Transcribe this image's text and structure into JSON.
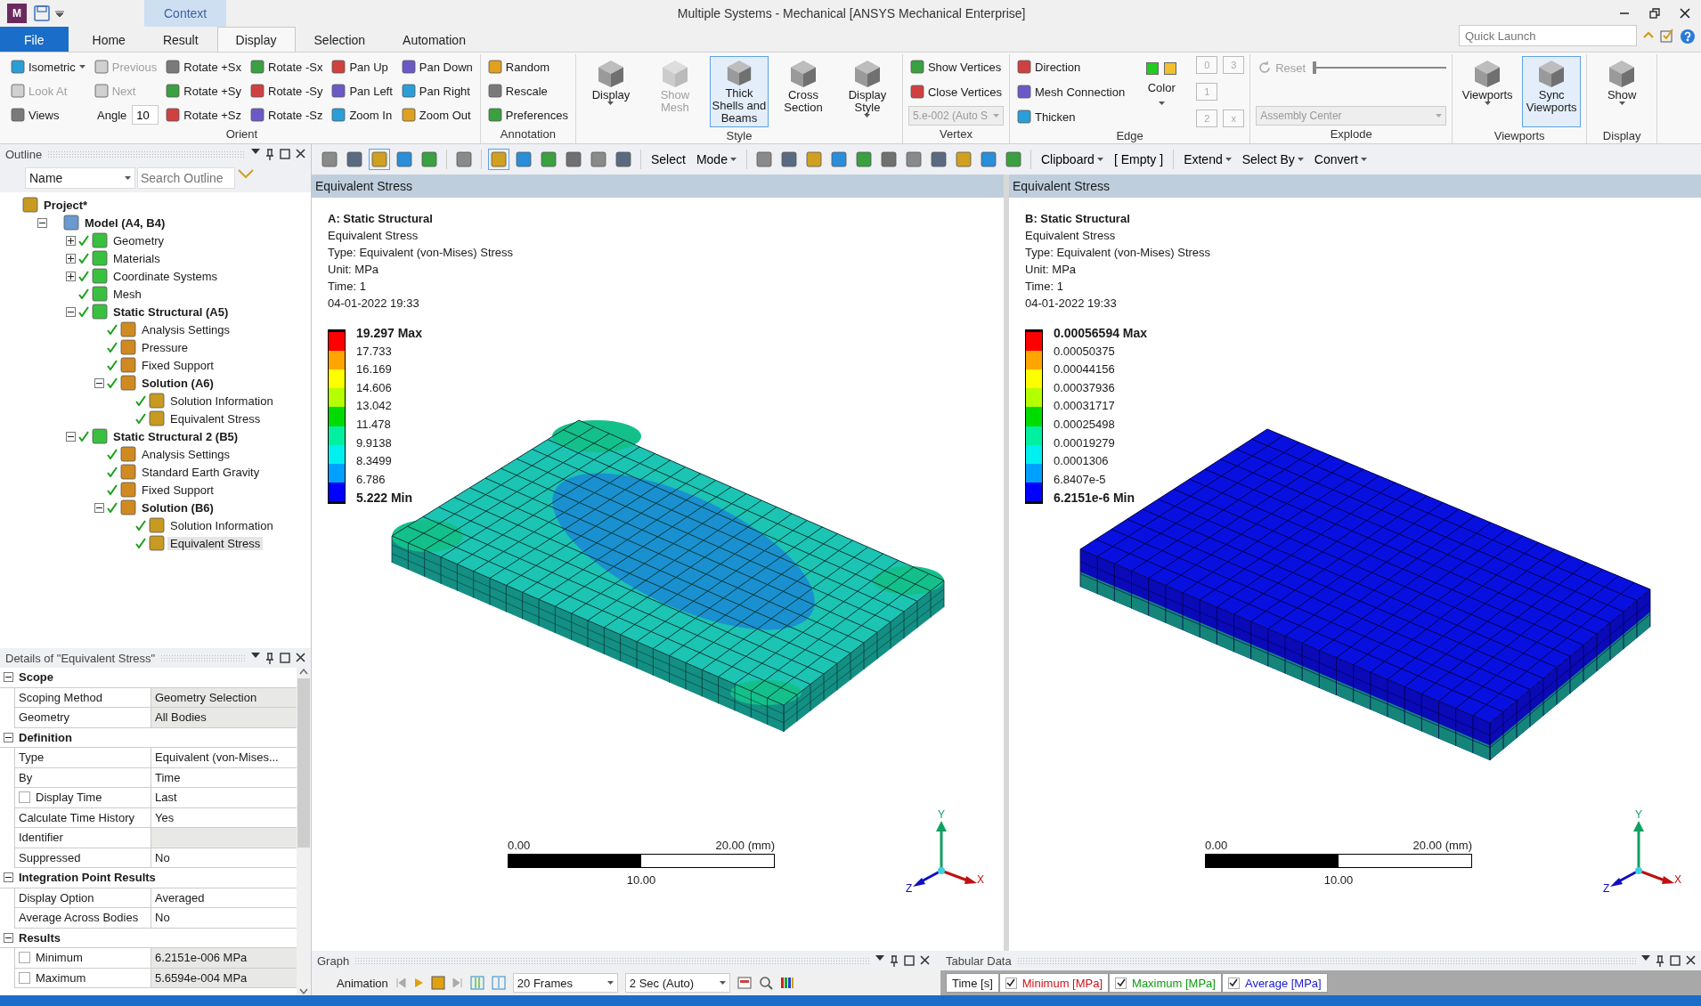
{
  "window": {
    "app_icon": "M",
    "context_tab": "Context",
    "title": "Multiple Systems - Mechanical [ANSYS Mechanical Enterprise]"
  },
  "quick_launch": {
    "placeholder": "Quick Launch"
  },
  "ribbon_tabs": [
    {
      "label": "File",
      "kind": "file",
      "selected": false
    },
    {
      "label": "Home",
      "kind": "tab",
      "selected": false
    },
    {
      "label": "Result",
      "kind": "tab",
      "selected": false
    },
    {
      "label": "Display",
      "kind": "tab",
      "selected": true
    },
    {
      "label": "Selection",
      "kind": "tab",
      "selected": false
    },
    {
      "label": "Automation",
      "kind": "tab",
      "selected": false
    }
  ],
  "ribbon_groups": [
    {
      "label": "Orient",
      "columns": [
        [
          {
            "kind": "small",
            "label": "Isometric",
            "dropdown": true,
            "disabled": false
          },
          {
            "kind": "small",
            "label": "Look At",
            "dropdown": false,
            "disabled": true
          },
          {
            "kind": "small",
            "label": "Views",
            "dropdown": false,
            "disabled": false
          }
        ],
        [
          {
            "kind": "small",
            "label": "Previous",
            "dropdown": false,
            "disabled": true
          },
          {
            "kind": "small",
            "label": "Next",
            "dropdown": false,
            "disabled": true
          },
          {
            "kind": "field",
            "label": "Angle",
            "value": "10"
          }
        ],
        [
          {
            "kind": "small",
            "label": "Rotate +Sx",
            "dropdown": false,
            "disabled": false
          },
          {
            "kind": "small",
            "label": "Rotate +Sy",
            "dropdown": false,
            "disabled": false
          },
          {
            "kind": "small",
            "label": "Rotate +Sz",
            "dropdown": false,
            "disabled": false
          }
        ],
        [
          {
            "kind": "small",
            "label": "Rotate -Sx",
            "dropdown": false,
            "disabled": false
          },
          {
            "kind": "small",
            "label": "Rotate -Sy",
            "dropdown": false,
            "disabled": false
          },
          {
            "kind": "small",
            "label": "Rotate -Sz",
            "dropdown": false,
            "disabled": false
          }
        ],
        [
          {
            "kind": "small",
            "label": "Pan Up",
            "dropdown": false,
            "disabled": false
          },
          {
            "kind": "small",
            "label": "Pan Left",
            "dropdown": false,
            "disabled": false
          },
          {
            "kind": "small",
            "label": "Zoom In",
            "dropdown": false,
            "disabled": false
          }
        ],
        [
          {
            "kind": "small",
            "label": "Pan Down",
            "dropdown": false,
            "disabled": false
          },
          {
            "kind": "small",
            "label": "Pan Right",
            "dropdown": false,
            "disabled": false
          },
          {
            "kind": "small",
            "label": "Zoom Out",
            "dropdown": false,
            "disabled": false
          }
        ]
      ]
    },
    {
      "label": "Annotation",
      "columns": [
        [
          {
            "kind": "small",
            "label": "Random",
            "dropdown": false,
            "disabled": false
          },
          {
            "kind": "small",
            "label": "Rescale",
            "dropdown": false,
            "disabled": false
          },
          {
            "kind": "small",
            "label": "Preferences",
            "dropdown": false,
            "disabled": false
          }
        ]
      ]
    },
    {
      "label": "Style",
      "columns": [
        [
          {
            "kind": "large",
            "label": "Display",
            "dropdown": true,
            "disabled": false,
            "selected": false
          }
        ],
        [
          {
            "kind": "large",
            "label": "Show Mesh",
            "dropdown": false,
            "disabled": true,
            "selected": false
          }
        ],
        [
          {
            "kind": "large",
            "label": "Thick Shells and Beams",
            "dropdown": false,
            "disabled": false,
            "selected": true
          }
        ],
        [
          {
            "kind": "large",
            "label": "Cross Section",
            "dropdown": false,
            "disabled": false,
            "selected": false
          }
        ],
        [
          {
            "kind": "large",
            "label": "Display Style",
            "dropdown": true,
            "disabled": false,
            "selected": false
          }
        ]
      ]
    },
    {
      "label": "Vertex",
      "columns": [
        [
          {
            "kind": "small",
            "label": "Show Vertices",
            "dropdown": false,
            "disabled": false
          },
          {
            "kind": "small",
            "label": "Close Vertices",
            "dropdown": false,
            "disabled": false
          },
          {
            "kind": "combo",
            "value": "5.e-002 (Auto S",
            "disabled": true
          }
        ]
      ]
    },
    {
      "label": "Edge",
      "columns": [
        [
          {
            "kind": "small",
            "label": "Direction",
            "dropdown": false,
            "disabled": false
          },
          {
            "kind": "small",
            "label": "Mesh Connection",
            "dropdown": false,
            "disabled": false
          },
          {
            "kind": "small",
            "label": "Thicken",
            "dropdown": false,
            "disabled": false
          }
        ],
        [
          {
            "kind": "color",
            "label": "Color",
            "swatches": [
              {
                "color": "#22cc22"
              },
              {
                "color": "#f0c030"
              }
            ]
          }
        ],
        [
          {
            "kind": "mini",
            "label": "0",
            "disabled": true
          },
          {
            "kind": "mini",
            "label": "1",
            "disabled": true
          },
          {
            "kind": "mini",
            "label": "2",
            "disabled": true
          }
        ],
        [
          {
            "kind": "mini",
            "label": "3",
            "disabled": true
          },
          {
            "kind": "mini",
            "label": "x",
            "disabled": true
          }
        ]
      ]
    },
    {
      "label": "Explode",
      "columns": [
        [
          {
            "kind": "slider",
            "label": "Reset",
            "disabled": true,
            "level": 0
          },
          {
            "kind": "combo",
            "value": "Assembly Center",
            "disabled": true
          }
        ]
      ]
    },
    {
      "label": "Viewports",
      "columns": [
        [
          {
            "kind": "large",
            "label": "Viewports",
            "dropdown": true,
            "disabled": false,
            "selected": false
          }
        ],
        [
          {
            "kind": "large",
            "label": "Sync Viewports",
            "dropdown": false,
            "disabled": false,
            "selected": true
          }
        ]
      ]
    },
    {
      "label": "Display",
      "columns": [
        [
          {
            "kind": "large",
            "label": "Show",
            "dropdown": true,
            "disabled": false,
            "selected": false
          }
        ]
      ]
    }
  ],
  "outline": {
    "title": "Outline",
    "filter": "Name",
    "search_placeholder": "Search Outline",
    "tree": [
      {
        "label": "Project*",
        "bold": true,
        "checked": false,
        "selected": false,
        "children": [
          {
            "label": "Model (A4, B4)",
            "bold": true,
            "checked": false,
            "selected": false,
            "expanded": true,
            "children": [
              {
                "label": "Geometry",
                "bold": false,
                "checked": true,
                "selected": false,
                "expanded": false
              },
              {
                "label": "Materials",
                "bold": false,
                "checked": true,
                "selected": false,
                "expanded": false
              },
              {
                "label": "Coordinate Systems",
                "bold": false,
                "checked": true,
                "selected": false,
                "expanded": false
              },
              {
                "label": "Mesh",
                "bold": false,
                "checked": true,
                "selected": false
              },
              {
                "label": "Static Structural (A5)",
                "bold": true,
                "checked": true,
                "selected": false,
                "expanded": true,
                "children": [
                  {
                    "label": "Analysis Settings",
                    "bold": false,
                    "checked": true,
                    "selected": false
                  },
                  {
                    "label": "Pressure",
                    "bold": false,
                    "checked": true,
                    "selected": false
                  },
                  {
                    "label": "Fixed Support",
                    "bold": false,
                    "checked": true,
                    "selected": false
                  },
                  {
                    "label": "Solution (A6)",
                    "bold": true,
                    "checked": true,
                    "selected": false,
                    "expanded": true,
                    "children": [
                      {
                        "label": "Solution Information",
                        "bold": false,
                        "checked": true,
                        "selected": false
                      },
                      {
                        "label": "Equivalent Stress",
                        "bold": false,
                        "checked": true,
                        "selected": false
                      }
                    ]
                  }
                ]
              },
              {
                "label": "Static Structural 2 (B5)",
                "bold": true,
                "checked": true,
                "selected": false,
                "expanded": true,
                "children": [
                  {
                    "label": "Analysis Settings",
                    "bold": false,
                    "checked": true,
                    "selected": false
                  },
                  {
                    "label": "Standard Earth Gravity",
                    "bold": false,
                    "checked": true,
                    "selected": false
                  },
                  {
                    "label": "Fixed Support",
                    "bold": false,
                    "checked": true,
                    "selected": false
                  },
                  {
                    "label": "Solution (B6)",
                    "bold": true,
                    "checked": true,
                    "selected": false,
                    "expanded": true,
                    "children": [
                      {
                        "label": "Solution Information",
                        "bold": false,
                        "checked": true,
                        "selected": false
                      },
                      {
                        "label": "Equivalent Stress",
                        "bold": false,
                        "checked": true,
                        "selected": true
                      }
                    ]
                  }
                ]
              }
            ]
          }
        ]
      }
    ]
  },
  "details": {
    "title": "Details of \"Equivalent Stress\"",
    "sections": [
      {
        "label": "Scope",
        "expanded": true,
        "rows": [
          {
            "kind": "plain",
            "label": "Scoping Method",
            "value": "Geometry Selection",
            "readonly": true
          },
          {
            "kind": "plain",
            "label": "Geometry",
            "value": "All Bodies",
            "readonly": true
          }
        ]
      },
      {
        "label": "Definition",
        "expanded": true,
        "rows": [
          {
            "kind": "plain",
            "label": "Type",
            "value": "Equivalent (von-Mises...",
            "readonly": false
          },
          {
            "kind": "plain",
            "label": "By",
            "value": "Time",
            "readonly": false
          },
          {
            "kind": "check",
            "label": "Display Time",
            "value": "Last",
            "readonly": false,
            "checked": false
          },
          {
            "kind": "plain",
            "label": "Calculate Time History",
            "value": "Yes",
            "readonly": false
          },
          {
            "kind": "plain",
            "label": "Identifier",
            "readonly": true
          },
          {
            "kind": "plain",
            "label": "Suppressed",
            "value": "No",
            "readonly": false
          }
        ]
      },
      {
        "label": "Integration Point Results",
        "expanded": true,
        "rows": [
          {
            "kind": "plain",
            "label": "Display Option",
            "value": "Averaged",
            "readonly": false
          },
          {
            "kind": "plain",
            "label": "Average Across Bodies",
            "value": "No",
            "readonly": false
          }
        ]
      },
      {
        "label": "Results",
        "expanded": true,
        "rows": [
          {
            "kind": "check",
            "label": "Minimum",
            "value": "6.2151e-006 MPa",
            "readonly": true,
            "checked": false
          },
          {
            "kind": "check",
            "label": "Maximum",
            "value": "5.6594e-004 MPa",
            "readonly": true,
            "checked": false
          }
        ]
      }
    ]
  },
  "graphics_toolbar": [
    {
      "kind": "icon",
      "selected": false
    },
    {
      "kind": "icon",
      "selected": false
    },
    {
      "kind": "icon",
      "selected": true
    },
    {
      "kind": "icon",
      "selected": false
    },
    {
      "kind": "icon",
      "selected": false
    },
    {
      "kind": "sep"
    },
    {
      "kind": "icon",
      "selected": false
    },
    {
      "kind": "sep"
    },
    {
      "kind": "icon",
      "selected": true
    },
    {
      "kind": "icon",
      "selected": false
    },
    {
      "kind": "icon",
      "selected": false
    },
    {
      "kind": "icon",
      "selected": false
    },
    {
      "kind": "icon",
      "selected": false
    },
    {
      "kind": "icon",
      "selected": false
    },
    {
      "kind": "sep"
    },
    {
      "kind": "text",
      "label": "Select",
      "dropdown": false
    },
    {
      "kind": "text",
      "label": "Mode",
      "dropdown": true
    },
    {
      "kind": "sep"
    },
    {
      "kind": "icon",
      "selected": false
    },
    {
      "kind": "icon",
      "selected": false
    },
    {
      "kind": "icon",
      "selected": false
    },
    {
      "kind": "icon",
      "selected": false
    },
    {
      "kind": "icon",
      "selected": false
    },
    {
      "kind": "icon",
      "selected": false
    },
    {
      "kind": "icon",
      "selected": false
    },
    {
      "kind": "icon",
      "selected": false
    },
    {
      "kind": "icon",
      "selected": false
    },
    {
      "kind": "icon",
      "selected": false
    },
    {
      "kind": "icon",
      "selected": false
    },
    {
      "kind": "sep"
    },
    {
      "kind": "text",
      "label": "Clipboard",
      "dropdown": true
    },
    {
      "kind": "text",
      "label": "[ Empty ]",
      "dropdown": false
    },
    {
      "kind": "sep"
    },
    {
      "kind": "text",
      "label": "Extend",
      "dropdown": true
    },
    {
      "kind": "text",
      "label": "Select By",
      "dropdown": true
    },
    {
      "kind": "text",
      "label": "Convert",
      "dropdown": true
    }
  ],
  "viewports": [
    {
      "header": "Equivalent Stress",
      "kind": "varied",
      "title": "A: Static Structural",
      "lines": [
        "Equivalent Stress",
        "Type: Equivalent (von-Mises) Stress",
        "Unit: MPa",
        "Time: 1",
        "04-01-2022 19:33"
      ],
      "legend": [
        "19.297 Max",
        "17.733",
        "16.169",
        "14.606",
        "13.042",
        "11.478",
        "9.9138",
        "8.3499",
        "6.786",
        "5.222 Min"
      ],
      "scale": {
        "start": "0.00",
        "end": "20.00 (mm)",
        "mid": "10.00"
      },
      "axes": [
        "Y",
        "X",
        "Z"
      ]
    },
    {
      "header": "Equivalent Stress",
      "kind": "uniform",
      "title": "B: Static Structural",
      "lines": [
        "Equivalent Stress",
        "Type: Equivalent (von-Mises) Stress",
        "Unit: MPa",
        "Time: 1",
        "04-01-2022 19:33"
      ],
      "legend": [
        "0.00056594 Max",
        "0.00050375",
        "0.00044156",
        "0.00037936",
        "0.00031717",
        "0.00025498",
        "0.00019279",
        "0.0001306",
        "6.8407e-5",
        "6.2151e-6 Min"
      ],
      "scale": {
        "start": "0.00",
        "end": "20.00 (mm)",
        "mid": "10.00"
      },
      "axes": [
        "Y",
        "X",
        "Z"
      ]
    }
  ],
  "graph_panel": {
    "title": "Graph",
    "animation_label": "Animation",
    "frames": "20 Frames",
    "duration": "2 Sec (Auto)"
  },
  "tabular_panel": {
    "title": "Tabular Data",
    "first_column": "Time [s]",
    "columns": [
      {
        "label": "Minimum [MPa]",
        "color": "#d0101a",
        "checked": true
      },
      {
        "label": "Maximum [MPa]",
        "color": "#109a10",
        "checked": true
      },
      {
        "label": "Average [MPa]",
        "color": "#1a1ad0",
        "checked": true
      }
    ]
  }
}
